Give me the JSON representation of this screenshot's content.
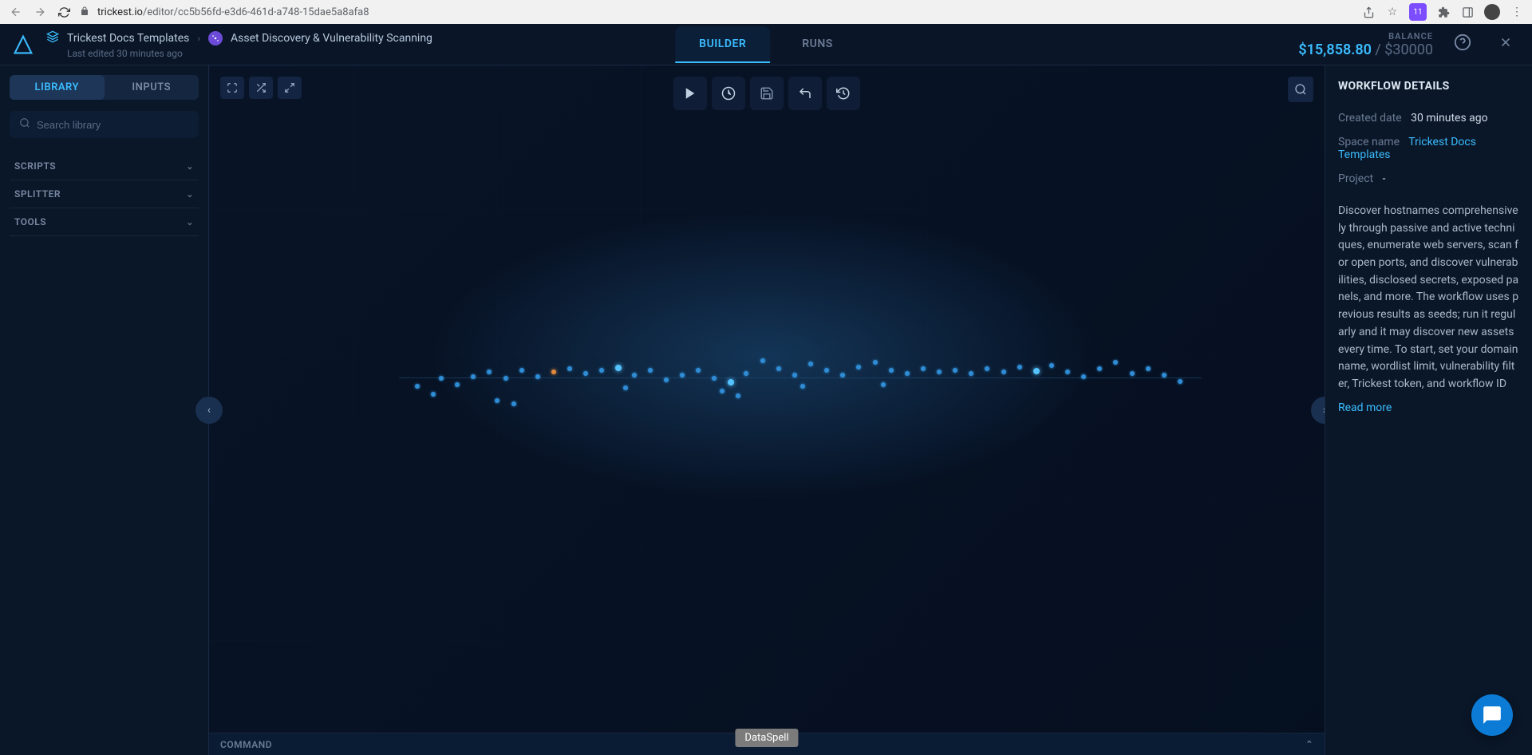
{
  "browser": {
    "url_domain": "trickest.io",
    "url_path": "/editor/cc5b56fd-e3d6-461d-a748-15dae5a8afa8",
    "ext_badge": "11"
  },
  "header": {
    "breadcrumb_space": "Trickest Docs Templates",
    "breadcrumb_workflow": "Asset Discovery & Vulnerability Scanning",
    "last_edited": "Last edited 30 minutes ago",
    "tab_builder": "BUILDER",
    "tab_runs": "RUNS",
    "balance_label": "BALANCE",
    "balance_current": "$15,858.80",
    "balance_separator": " / ",
    "balance_total": "$30000"
  },
  "sidebar": {
    "tab_library": "LIBRARY",
    "tab_inputs": "INPUTS",
    "search_placeholder": "Search library",
    "sections": [
      {
        "label": "SCRIPTS"
      },
      {
        "label": "SPLITTER"
      },
      {
        "label": "TOOLS"
      }
    ]
  },
  "canvas": {
    "command_label": "COMMAND",
    "tooltip": "DataSpell"
  },
  "details": {
    "title": "WORKFLOW DETAILS",
    "created_label": "Created date",
    "created_value": "30 minutes ago",
    "space_label": "Space name",
    "space_value": "Trickest Docs Templates",
    "project_label": "Project",
    "project_value": "-",
    "description": "Discover hostnames comprehensively through passive and active techniques, enumerate web servers, scan for open ports, and discover vulnerabilities, disclosed secrets, exposed panels, and more. The workflow uses previous results as seeds; run it regularly and it may discover new assets every time. To start, set your domain name, wordlist limit, vulnerability filter, Trickest token, and workflow ID",
    "read_more": "Read more"
  }
}
